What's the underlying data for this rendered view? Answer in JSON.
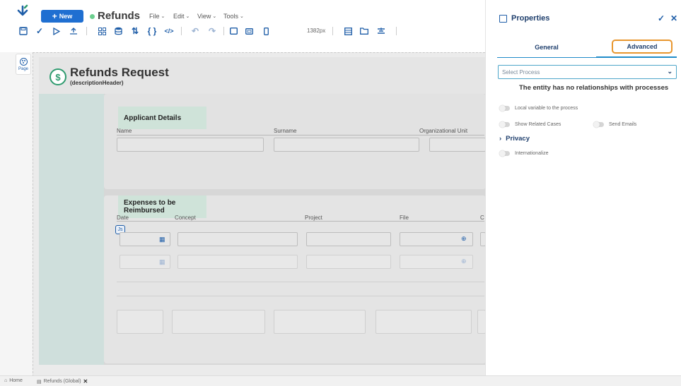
{
  "app": {
    "title": "Refunds",
    "new_label": "New",
    "status_color": "#6ccf8e",
    "accent": "#1f5ea8"
  },
  "menus": [
    {
      "label": "File"
    },
    {
      "label": "Edit"
    },
    {
      "label": "View"
    },
    {
      "label": "Tools"
    }
  ],
  "toolbar": {
    "width_readout": "1382px",
    "icons": [
      "save-icon",
      "check-icon",
      "play-icon",
      "upload-icon",
      "layout-icon",
      "database-icon",
      "sort-icon",
      "braces-icon",
      "code-icon",
      "undo-icon",
      "redo-icon",
      "desktop-icon",
      "tablet-icon",
      "mobile-icon",
      "form-icon",
      "folder-icon",
      "align-icon"
    ]
  },
  "rail": {
    "page_label": "Page"
  },
  "form": {
    "title": "Refunds Request",
    "subtitle": "(descriptionHeader)",
    "applicant": {
      "title": "Applicant Details",
      "fields": [
        "Name",
        "Surname",
        "Organizational Unit"
      ]
    },
    "expenses": {
      "title": "Expenses to be Reimbursed",
      "columns": [
        "Date",
        "Concept",
        "Project",
        "File",
        "C"
      ],
      "js_badge": "Js"
    }
  },
  "panel": {
    "title": "Properties",
    "tabs": [
      {
        "label": "General"
      },
      {
        "label": "Advanced"
      }
    ],
    "select_placeholder": "Select Process",
    "no_relationships": "The entity has no relationships with processes",
    "local_variable": "Local variable to the process",
    "show_related": "Show Related Cases",
    "send_emails": "Send Emails",
    "privacy": "Privacy",
    "internationalize": "Internationalize",
    "highlight_color": "#e8962e"
  },
  "bottom": {
    "home": "Home",
    "tab": "Refunds (Global)"
  }
}
